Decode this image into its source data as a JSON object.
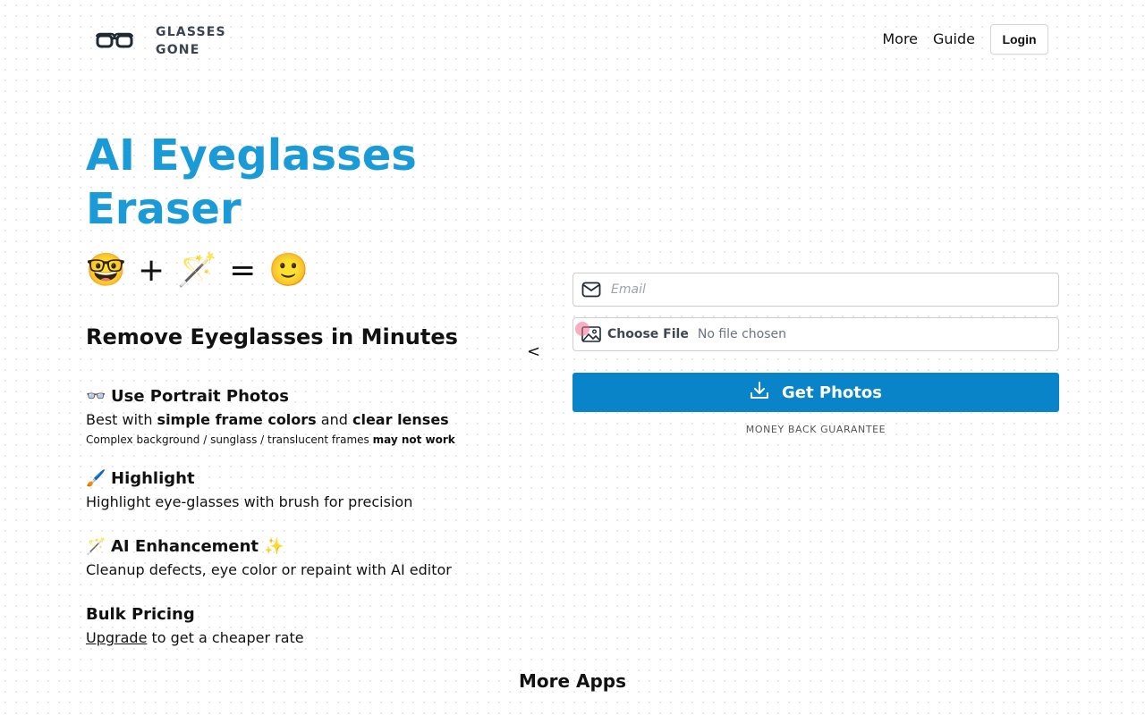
{
  "header": {
    "brand_line1": "GLASSES",
    "brand_line2": "GONE",
    "logo_icon": "eyeglasses-icon",
    "nav": {
      "more": "More",
      "guide": "Guide",
      "login": "Login"
    }
  },
  "hero": {
    "title": "AI Eyeglasses Eraser",
    "equation": {
      "left_emoji": "🤓",
      "plus": "+",
      "wand_emoji": "🪄",
      "equals": "=",
      "result_emoji": "🙂"
    },
    "subtitle": "Remove Eyeglasses in Minutes",
    "chevron": "<"
  },
  "features": [
    {
      "icon": "👓",
      "title": "Use Portrait Photos",
      "line1_a": "Best with ",
      "line1_b": "simple frame colors",
      "line1_c": " and ",
      "line1_d": "clear lenses",
      "line2_a": "Complex background / sunglass / translucent frames ",
      "line2_b": "may not work"
    },
    {
      "icon": "🖌️",
      "title": "Highlight",
      "text": "Highlight eye-glasses with brush for precision"
    },
    {
      "icon": "🪄",
      "title": "AI Enhancement",
      "suffix_icon": "✨",
      "text": "Cleanup defects, eye color or repaint with AI editor"
    },
    {
      "title": "Bulk Pricing",
      "link": "Upgrade",
      "text": " to get a cheaper rate"
    }
  ],
  "form": {
    "email_placeholder": "Email",
    "email_value": "",
    "file_button": "Choose File",
    "file_status": "No file chosen",
    "submit": "Get Photos",
    "guarantee": "MONEY BACK GUARANTEE"
  },
  "footer": {
    "more_apps": "More Apps"
  },
  "colors": {
    "accent_title": "#1a9ad6",
    "button": "#0a84c9"
  }
}
